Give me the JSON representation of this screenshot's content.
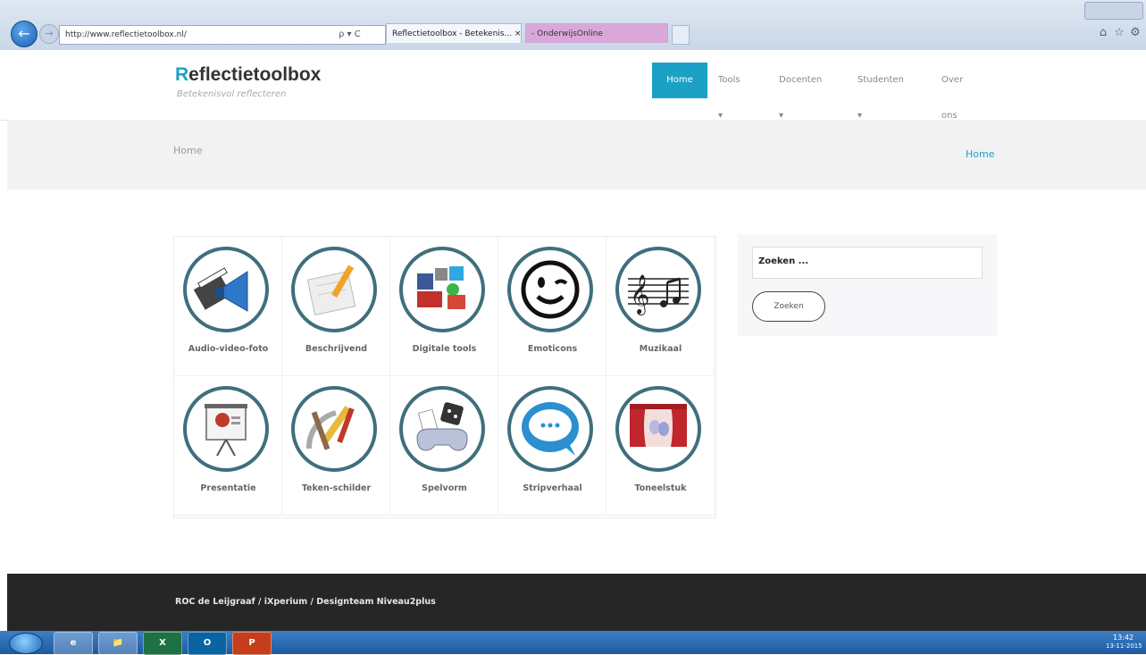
{
  "browser": {
    "address": "http://www.reflectietoolbox.nl/",
    "address_tools": "ρ ▾ C",
    "tabs": [
      {
        "label": "Reflectietoolbox - Betekenis... ×"
      },
      {
        "label": "- OnderwijsOnline"
      }
    ]
  },
  "site": {
    "logo_first": "R",
    "logo_rest": "eflectietoolbox",
    "tagline": "Betekenisvol reflecteren",
    "nav": {
      "home": "Home",
      "tools": "Tools ▾",
      "docenten": "Docenten ▾",
      "studenten": "Studenten ▾",
      "over": "Over ons"
    },
    "page_title": "Home",
    "breadcrumb": "Home"
  },
  "tools": [
    {
      "label": "Audio-video-foto",
      "icon": "megaphone-clapper-icon"
    },
    {
      "label": "Beschrijvend",
      "icon": "notepad-pencil-icon"
    },
    {
      "label": "Digitale tools",
      "icon": "social-media-icon"
    },
    {
      "label": "Emoticons",
      "icon": "winking-smiley-icon"
    },
    {
      "label": "Muzikaal",
      "icon": "music-notes-icon"
    },
    {
      "label": "Presentatie",
      "icon": "presentation-board-icon"
    },
    {
      "label": "Teken-schilder",
      "icon": "drawing-tools-icon"
    },
    {
      "label": "Spelvorm",
      "icon": "game-controller-icon"
    },
    {
      "label": "Stripverhaal",
      "icon": "speech-bubble-icon"
    },
    {
      "label": "Toneelstuk",
      "icon": "theater-stage-icon"
    }
  ],
  "search": {
    "placeholder": "Zoeken ...",
    "button": "Zoeken"
  },
  "footer": {
    "text": "ROC de Leijgraaf / iXperium / Designteam Niveau2plus"
  },
  "taskbar": {
    "apps": [
      "e",
      "📁",
      "X",
      "O",
      "P"
    ],
    "time": "13:42",
    "date": "13-11-2015"
  },
  "colors": {
    "accent": "#1ba1c4",
    "circle_border": "#3f6f7c",
    "footer_bg": "#262626"
  }
}
